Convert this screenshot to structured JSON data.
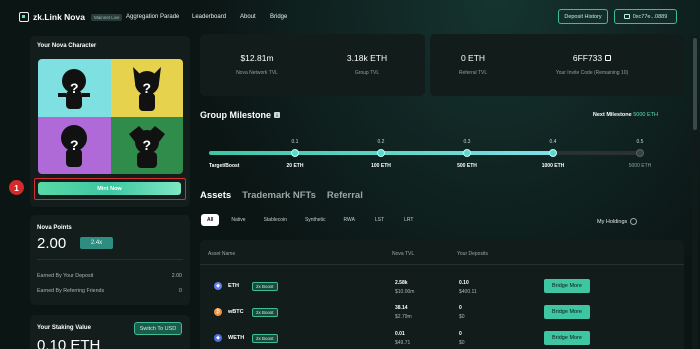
{
  "app": {
    "logo_text": "zk.Link Nova",
    "logo_badge": "Mainnet Live"
  },
  "nav": {
    "links": [
      "Aggregation Parade",
      "Leaderboard",
      "About",
      "Bridge"
    ],
    "deposit_history": "Deposit History",
    "wallet": "0xc77e...0889"
  },
  "character": {
    "title": "Your Nova Character",
    "mint_label": "Mint Now",
    "step_number": "1"
  },
  "points": {
    "title": "Nova Points",
    "value": "2.00",
    "multiplier": "2.4x",
    "rows": [
      {
        "label": "Earned By Your Deposit",
        "value": "2.00"
      },
      {
        "label": "Earned By Referring Friends",
        "value": "0"
      }
    ]
  },
  "staking": {
    "title": "Your Staking Value",
    "switch_label": "Switch To USD",
    "value": "0.10 ETH"
  },
  "stats": [
    {
      "value": "$12.81m",
      "label": "Nova Network TVL"
    },
    {
      "value": "3.18k ETH",
      "label": "Group TVL"
    },
    {
      "value": "0 ETH",
      "label": "Referral TVL"
    },
    {
      "value": "6FF733",
      "label": "Your Invite Code (Remaining 10)"
    }
  ],
  "milestone": {
    "title": "Group Milestone",
    "next_label": "Next Milestone",
    "next_value": "5000 ETH",
    "target_label": "Target/Boost",
    "points": [
      {
        "pct": "0.1",
        "amount": "20 ETH",
        "reached": true
      },
      {
        "pct": "0.2",
        "amount": "100 ETH",
        "reached": true
      },
      {
        "pct": "0.3",
        "amount": "500 ETH",
        "reached": true
      },
      {
        "pct": "0.4",
        "amount": "1000 ETH",
        "reached": true
      },
      {
        "pct": "0.5",
        "amount": "5000 ETH",
        "reached": false
      }
    ],
    "progress": 0.8
  },
  "tabs": [
    "Assets",
    "Trademark NFTs",
    "Referral"
  ],
  "filters": [
    "All",
    "Native",
    "Stablecoin",
    "Synthetic",
    "RWA",
    "LST",
    "LRT"
  ],
  "holdings_label": "My Holdings",
  "table": {
    "headers": [
      "Asset Name",
      "Nova TVL",
      "Your Deposits"
    ],
    "rows": [
      {
        "name": "ETH",
        "boost": "2x Boost",
        "tvl_top": "2.58k",
        "tvl_bot": "$10.00m",
        "dep_top": "0.10",
        "dep_bot": "$400.11",
        "action": "Bridge More",
        "icon_color": "#627eea"
      },
      {
        "name": "wBTC",
        "boost": "2x Boost",
        "tvl_top": "38.14",
        "tvl_bot": "$2.79m",
        "dep_top": "0",
        "dep_bot": "$0",
        "action": "Bridge More",
        "icon_color": "#f09242"
      },
      {
        "name": "WETH",
        "boost": "2x Boost",
        "tvl_top": "0.01",
        "tvl_bot": "$49.71",
        "dep_top": "0",
        "dep_bot": "$0",
        "action": "Bridge More",
        "icon_color": "#4a6ee0"
      }
    ]
  },
  "colors": {
    "accent": "#3ec6a2",
    "highlight_border": "#d62f2f",
    "background": "#0b1514"
  }
}
